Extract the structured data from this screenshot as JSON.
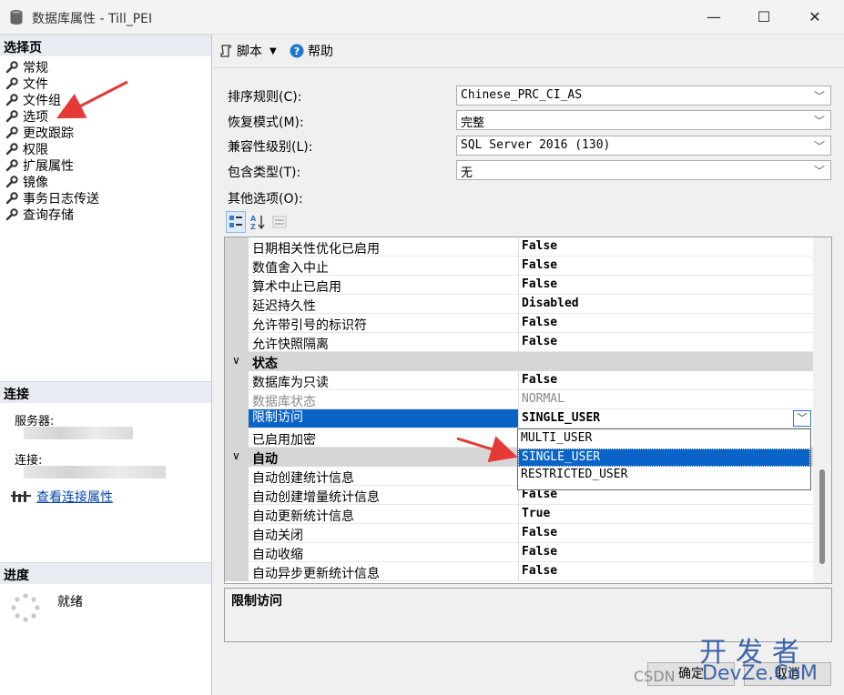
{
  "window": {
    "title": "数据库属性 - Till_PEI",
    "minimize_glyph": "—",
    "maximize_glyph": "☐",
    "close_glyph": "✕"
  },
  "left_panel": {
    "select_page_header": "选择页",
    "nav_items": [
      "常规",
      "文件",
      "文件组",
      "选项",
      "更改跟踪",
      "权限",
      "扩展属性",
      "镜像",
      "事务日志传送",
      "查询存储"
    ],
    "connection_header": "连接",
    "server_label": "服务器:",
    "connection_label": "连接:",
    "view_connection_link": "查看连接属性",
    "progress_header": "进度",
    "progress_status": "就绪"
  },
  "toolbar": {
    "script_label": "脚本",
    "help_label": "帮助"
  },
  "form": {
    "collation_label": "排序规则(C):",
    "collation_value": "Chinese_PRC_CI_AS",
    "recovery_label": "恢复模式(M):",
    "recovery_value": "完整",
    "compat_label": "兼容性级别(L):",
    "compat_value": "SQL Server 2016 (130)",
    "containment_label": "包含类型(T):",
    "containment_value": "无",
    "other_options_label": "其他选项(O):"
  },
  "property_grid": {
    "rows": [
      {
        "name": "日期相关性优化已启用",
        "value": "False"
      },
      {
        "name": "数值舍入中止",
        "value": "False"
      },
      {
        "name": "算术中止已启用",
        "value": "False"
      },
      {
        "name": "延迟持久性",
        "value": "Disabled"
      },
      {
        "name": "允许带引号的标识符",
        "value": "False"
      },
      {
        "name": "允许快照隔离",
        "value": "False"
      }
    ],
    "state_category": "状态",
    "state_rows": [
      {
        "name": "数据库为只读",
        "value": "False"
      },
      {
        "name": "数据库状态",
        "value": "NORMAL"
      },
      {
        "name": "限制访问",
        "value": "SINGLE_USER"
      },
      {
        "name": "已启用加密",
        "value": ""
      }
    ],
    "auto_category": "自动",
    "auto_rows": [
      {
        "name": "自动创建统计信息",
        "value": ""
      },
      {
        "name": "自动创建增量统计信息",
        "value": "False"
      },
      {
        "name": "自动更新统计信息",
        "value": "True"
      },
      {
        "name": "自动关闭",
        "value": "False"
      },
      {
        "name": "自动收缩",
        "value": "False"
      },
      {
        "name": "自动异步更新统计信息",
        "value": "False"
      }
    ],
    "dropdown_options": [
      "MULTI_USER",
      "SINGLE_USER",
      "RESTRICTED_USER"
    ],
    "dropdown_selected": "SINGLE_USER"
  },
  "description": {
    "title": "限制访问"
  },
  "buttons": {
    "ok": "确定",
    "cancel": "取消"
  },
  "watermark": {
    "line1": "开发者",
    "line2": "DevZe.CoM",
    "csdn": "CSDN"
  },
  "colors": {
    "selection": "#0a64c8",
    "category_bg": "#d6d6d6",
    "annotation_arrow": "#e53935",
    "link": "#0645ad"
  }
}
